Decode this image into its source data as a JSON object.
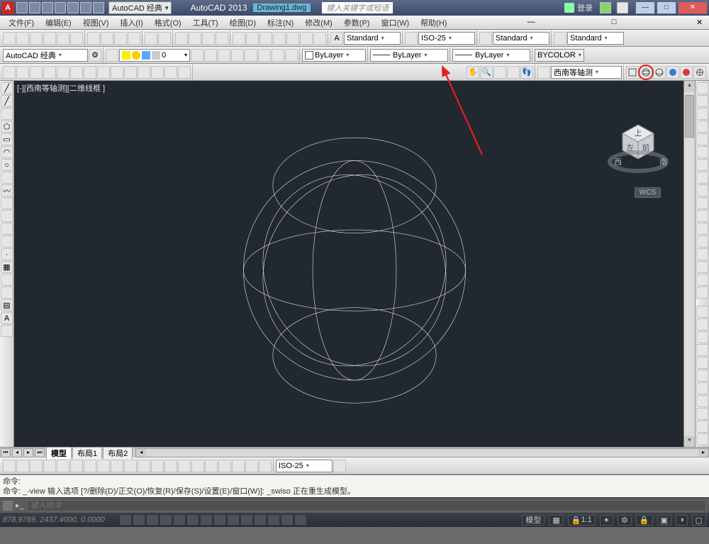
{
  "titlebar": {
    "workspace": "AutoCAD 经典",
    "app": "AutoCAD 2013",
    "drawing": "Drawing1.dwg",
    "search_placeholder": "键入关键字或短语",
    "login": "登录"
  },
  "menubar": {
    "items": [
      "文件(F)",
      "编辑(E)",
      "视图(V)",
      "插入(I)",
      "格式(O)",
      "工具(T)",
      "绘图(D)",
      "标注(N)",
      "修改(M)",
      "参数(P)",
      "窗口(W)",
      "帮助(H)"
    ]
  },
  "styles_row": {
    "textstyle": "Standard",
    "dimstyle": "ISO-25",
    "tablestyle": "Standard",
    "mlstyle": "Standard"
  },
  "layers_row": {
    "workspace": "AutoCAD 经典",
    "current_layer": "0",
    "color": "ByLayer",
    "linetype": "ByLayer",
    "lineweight": "ByLayer",
    "plotstyle": "BYCOLOR"
  },
  "view_row": {
    "view_name": "西南等轴测"
  },
  "viewport": {
    "title": "[-][西南等轴测][二维线框 ]",
    "wcs": "WCS"
  },
  "sheet_tabs": {
    "model": "模型",
    "layout1": "布局1",
    "layout2": "布局2"
  },
  "dim_toolbar": {
    "style": "ISO-25"
  },
  "command": {
    "line1": "命令:",
    "line2": "命令: _-view 输入选项 [?/删除(D)/正交(O)/恢复(R)/保存(S)/设置(E)/窗口(W)]: _swiso 正在重生成模型。",
    "prompt_placeholder": "键入命令"
  },
  "status": {
    "coords": "878.9789, 2437.4000, 0.0000",
    "space": "模型",
    "scale": "1:1"
  }
}
